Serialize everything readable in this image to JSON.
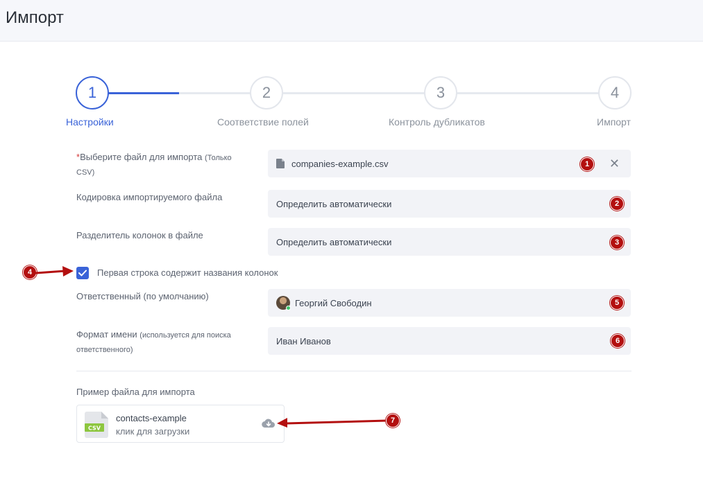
{
  "header": {
    "title": "Импорт"
  },
  "steps": [
    {
      "number": "1",
      "label": "Настройки",
      "active": true
    },
    {
      "number": "2",
      "label": "Соответствие полей",
      "active": false
    },
    {
      "number": "3",
      "label": "Контроль дубликатов",
      "active": false
    },
    {
      "number": "4",
      "label": "Импорт",
      "active": false
    }
  ],
  "form": {
    "file": {
      "required_mark": "*",
      "label": "Выберите файл для импорта",
      "label_note": "(Только CSV)",
      "value": "companies-example.csv",
      "clear_icon": "close-icon",
      "badge": "1"
    },
    "encoding": {
      "label": "Кодировка импортируемого файла",
      "value": "Определить автоматически",
      "badge": "2"
    },
    "delimiter": {
      "label": "Разделитель колонок в файле",
      "value": "Определить автоматически",
      "badge": "3"
    },
    "header_row": {
      "label": "Первая строка содержит названия колонок",
      "checked": true,
      "badge": "4"
    },
    "responsible": {
      "label": "Ответственный (по умолчанию)",
      "value": "Георгий Свободин",
      "badge": "5"
    },
    "name_format": {
      "label": "Формат имени",
      "label_note": "(используется для поиска ответственного)",
      "value": "Иван Иванов",
      "badge": "6"
    }
  },
  "sample": {
    "title": "Пример файла для импорта",
    "file_name": "contacts-example",
    "hint": "клик для загрузки",
    "file_type": "CSV",
    "badge": "7"
  },
  "colors": {
    "accent": "#3a63d8",
    "badge": "#b30f0f",
    "field_bg": "#f2f3f7"
  }
}
